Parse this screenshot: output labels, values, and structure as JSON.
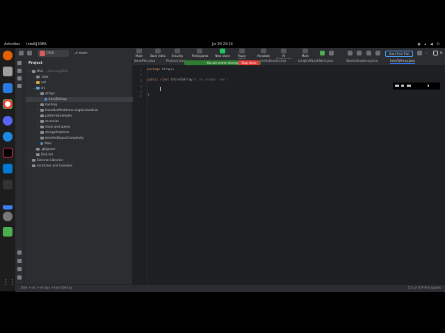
{
  "topbar": {
    "activities": "Activities",
    "app": "IntelliJ IDEA",
    "clock": "Jul 30  23:24"
  },
  "ide": {
    "project_name": "DSA",
    "project_badge": "DS",
    "branch": "main",
    "zoom_toolbar": [
      {
        "label": "Mute"
      },
      {
        "label": "Start video"
      },
      {
        "label": "Security"
      },
      {
        "label": "Participants"
      },
      {
        "label": "New share"
      },
      {
        "label": "Pause share"
      },
      {
        "label": "Annotate"
      },
      {
        "label": "AI Companion"
      },
      {
        "label": "More"
      }
    ],
    "trial_button": "Start Free Trial",
    "share_banner": "You are screen sharing",
    "stop_share": "Stop share"
  },
  "project_panel": {
    "title": "Project",
    "tree": [
      {
        "label": "DSA",
        "detail": "~/learning/DSA",
        "indent": 0,
        "twisty": "v",
        "icon": "folder"
      },
      {
        "label": ".idea",
        "indent": 1,
        "twisty": ">",
        "icon": "folder"
      },
      {
        "label": "out",
        "indent": 1,
        "twisty": ">",
        "icon": "folder-yellow"
      },
      {
        "label": "src",
        "indent": 1,
        "twisty": "v",
        "icon": "folder-blue"
      },
      {
        "label": "Arrays",
        "indent": 2,
        "twisty": "v",
        "icon": "folder"
      },
      {
        "label": "IntroToArray",
        "indent": 3,
        "twisty": "",
        "icon": "class",
        "selected": true
      },
      {
        "label": "hashing",
        "indent": 2,
        "twisty": ">",
        "icon": "folder"
      },
      {
        "label": "linkedListProblems.singleLinkedList",
        "indent": 2,
        "twisty": ">",
        "icon": "folder"
      },
      {
        "label": "patternsExamples",
        "indent": 2,
        "twisty": ">",
        "icon": "folder"
      },
      {
        "label": "recursion",
        "indent": 2,
        "twisty": ">",
        "icon": "folder"
      },
      {
        "label": "stack and queue",
        "indent": 2,
        "twisty": ">",
        "icon": "folder"
      },
      {
        "label": "stringsProblems",
        "indent": 2,
        "twisty": ">",
        "icon": "folder"
      },
      {
        "label": "timeAndSpaceComplexity",
        "indent": 2,
        "twisty": ">",
        "icon": "folder"
      },
      {
        "label": "Main",
        "indent": 2,
        "twisty": "",
        "icon": "class"
      },
      {
        "label": ".gitignore",
        "indent": 1,
        "twisty": "",
        "icon": "file"
      },
      {
        "label": "DSA.iml",
        "indent": 1,
        "twisty": "",
        "icon": "file"
      },
      {
        "label": "External Libraries",
        "indent": 0,
        "twisty": ">",
        "icon": "lib"
      },
      {
        "label": "Scratches and Consoles",
        "indent": 0,
        "twisty": "",
        "icon": "lib"
      }
    ]
  },
  "tabs": [
    {
      "label": "iberelRec.java",
      "active": false
    },
    {
      "label": "Practice.java",
      "active": false
    },
    {
      "label": "riorityQueue.java",
      "active": false
    },
    {
      "label": "LengthOfLastWord.java",
      "active": false
    },
    {
      "label": "StackUsingArray.java",
      "active": false
    },
    {
      "label": "IntroToArray.java",
      "active": true
    }
  ],
  "editor": {
    "line_numbers": [
      "1",
      "2",
      "3",
      "4",
      "5",
      "6"
    ],
    "lines": [
      {
        "kw": "package",
        "rest": " Arrays;"
      },
      {
        "kw": "",
        "rest": ""
      },
      {
        "kw": "public class",
        "rest": " IntroToArray {",
        "hint": "  no usages  new *"
      },
      {
        "kw": "",
        "rest": ""
      },
      {
        "kw": "",
        "rest": ""
      },
      {
        "kw": "",
        "rest": "}"
      }
    ]
  },
  "status": {
    "breadcrumb": "DSA  >  src  >  Arrays  >  IntroToArray",
    "right": "5:5    LF    UTF-8    4 spaces"
  },
  "colors": {
    "editor_bg": "#1e1f22",
    "panel_bg": "#2b2d30",
    "keyword": "#cf8e6d",
    "share_green": "#2e7d32",
    "stop_red": "#e53935"
  }
}
